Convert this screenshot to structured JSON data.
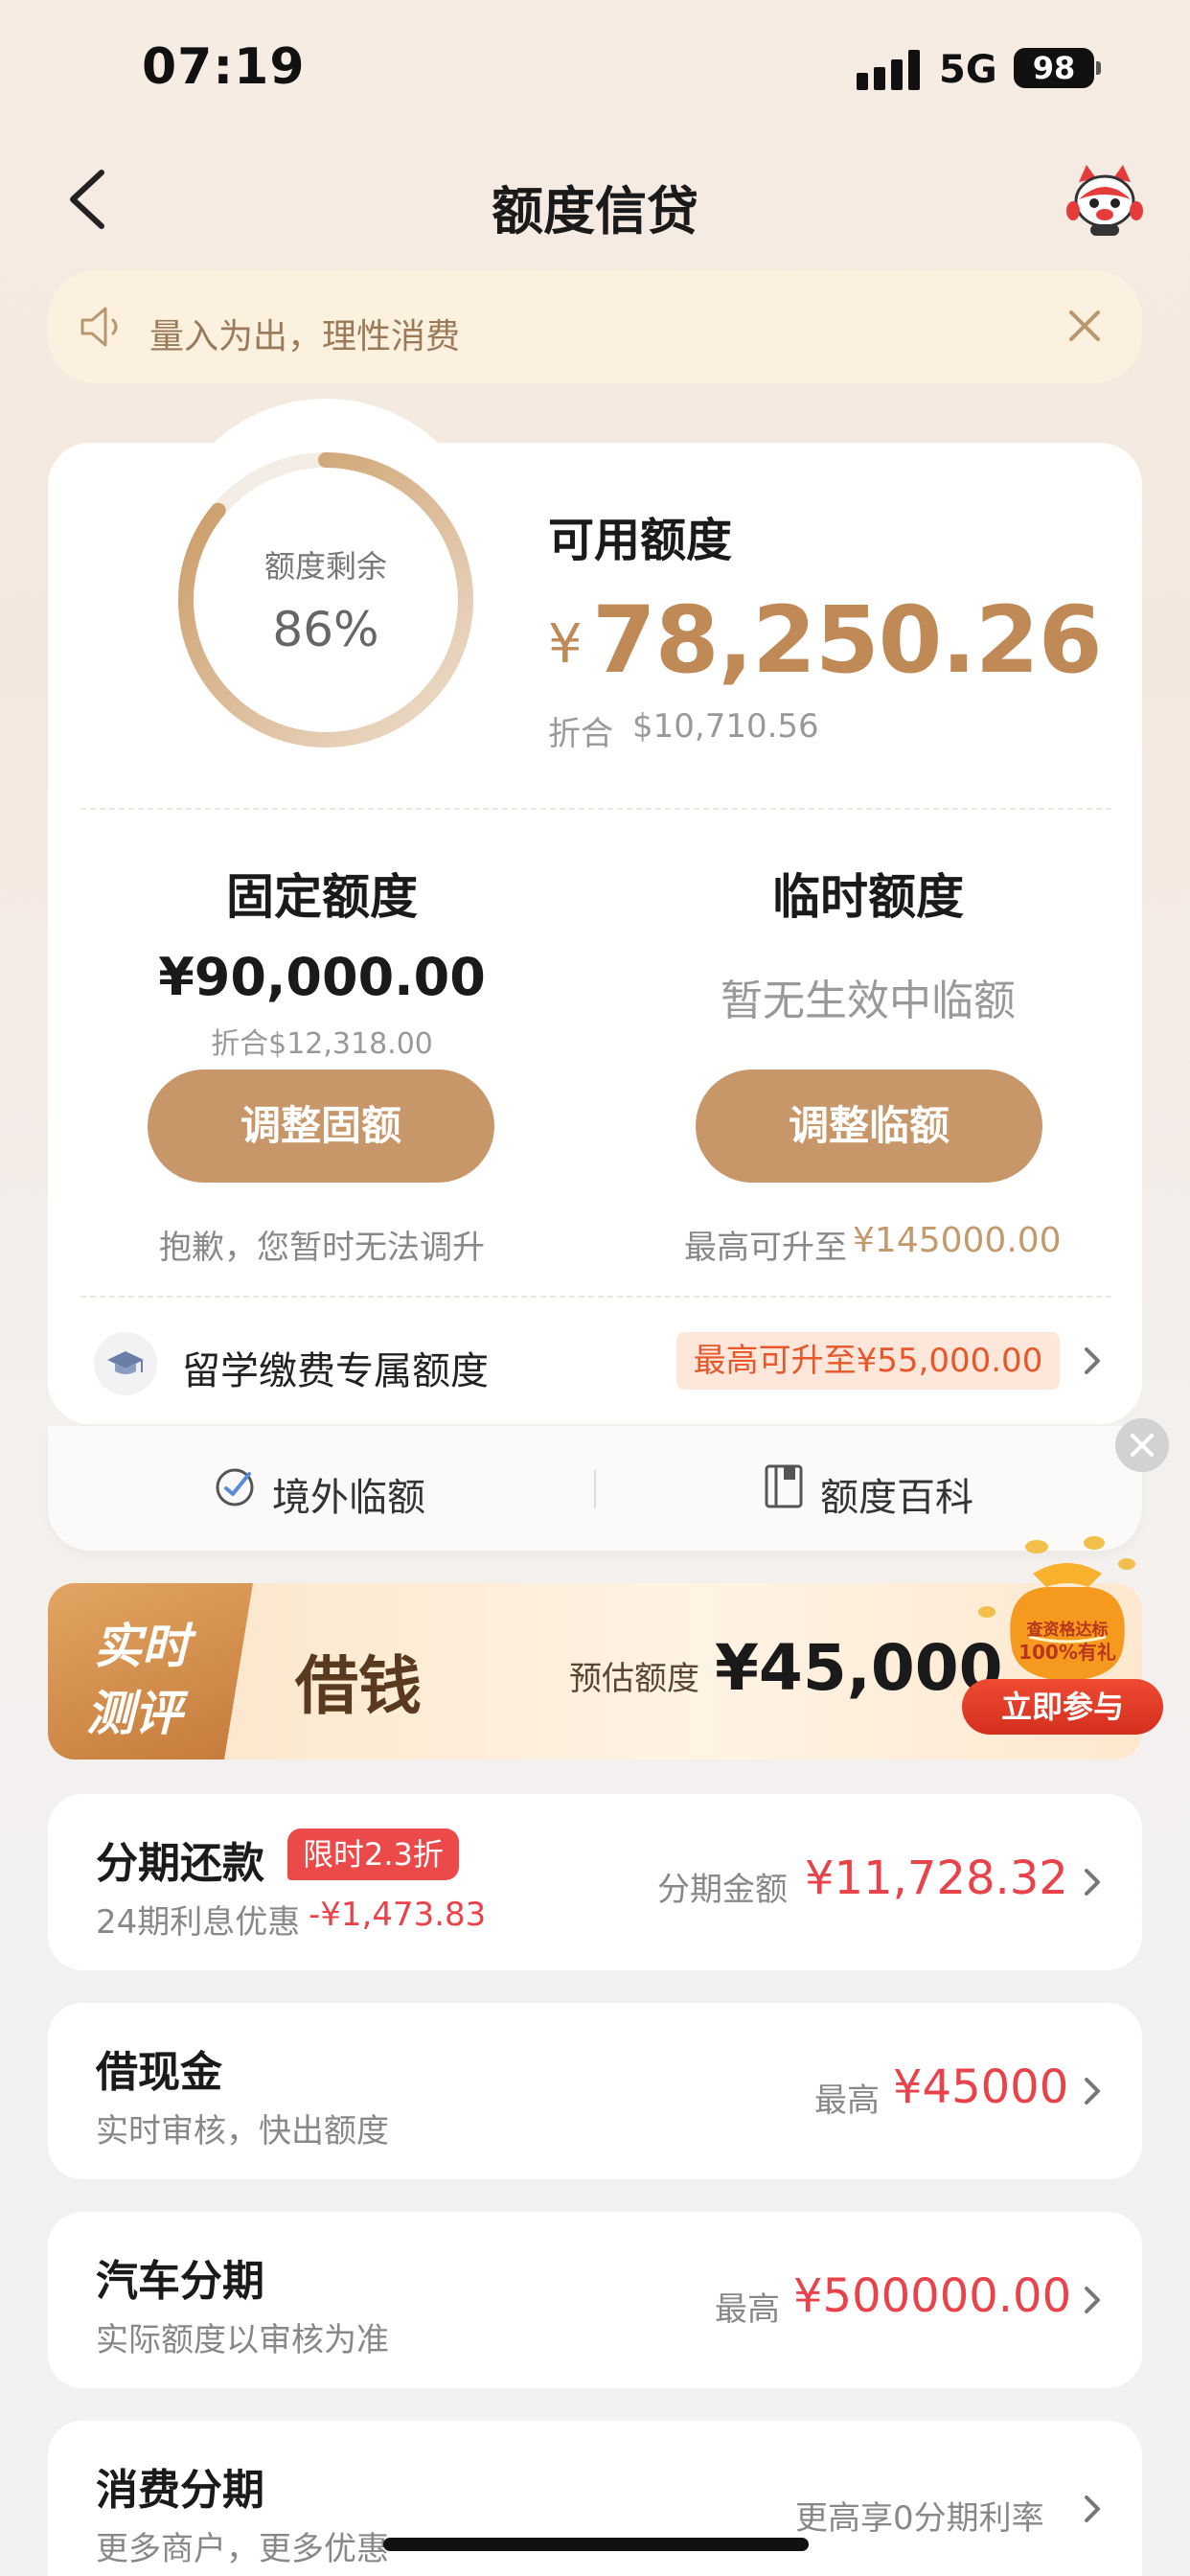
{
  "status_bar": {
    "time": "07:19",
    "network": "5G",
    "battery": "98"
  },
  "header": {
    "title": "额度信贷"
  },
  "notice": {
    "text": "量入为出，理性消费"
  },
  "summary": {
    "ring_label": "额度剩余",
    "ring_value": "86%",
    "ring_fraction": 0.86,
    "available_label": "可用额度",
    "available_currency": "¥",
    "available_amount": "78,250.26",
    "converted_label": "折合",
    "converted_amount": "$10,710.56"
  },
  "fixed_limit": {
    "title": "固定额度",
    "amount": "¥90,000.00",
    "converted": "折合$12,318.00",
    "button": "调整固额",
    "note": "抱歉，您暂时无法调升"
  },
  "temp_limit": {
    "title": "临时额度",
    "empty_text": "暂无生效中临额",
    "button": "调整临额",
    "note_label": "最高可升至",
    "note_value": "¥145000.00"
  },
  "study": {
    "label": "留学缴费专属额度",
    "badge": "最高可升至¥55,000.00"
  },
  "card_footer": {
    "item1": "境外临额",
    "item2": "额度百科"
  },
  "promo": {
    "tag_line1": "实时",
    "tag_line2": "测评",
    "title": "借钱",
    "estimate_label": "预估额度",
    "estimate_amount": "¥45,000",
    "bag_text1": "查资格达标",
    "bag_text2": "100%有礼",
    "join_button": "立即参与"
  },
  "list": [
    {
      "title": "分期还款",
      "badge": "限时2.3折",
      "subtitle": "24期利息优惠",
      "subtitle_accent": "-¥1,473.83",
      "right_label": "分期金额",
      "right_value": "¥11,728.32"
    },
    {
      "title": "借现金",
      "subtitle": "实时审核，快出额度",
      "right_label": "最高",
      "right_value": "¥45000"
    },
    {
      "title": "汽车分期",
      "subtitle": "实际额度以审核为准",
      "right_label": "最高",
      "right_value": "¥500000.00"
    },
    {
      "title": "消费分期",
      "subtitle": "更多商户，更多优惠",
      "right_label": "更高享0分期利率",
      "right_value": ""
    }
  ],
  "colors": {
    "accent_gold": "#c7976a",
    "price_red": "#e8434b",
    "badge_red": "#ec4a4a",
    "notice_bg": "#fcf1de"
  }
}
